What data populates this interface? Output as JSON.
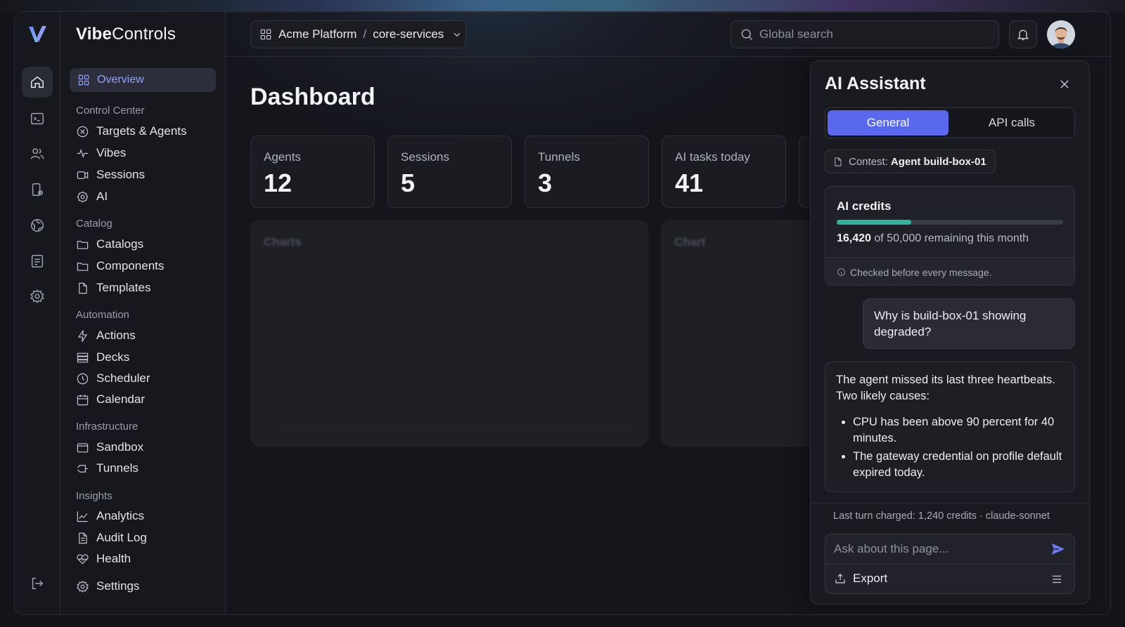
{
  "brand": {
    "bold": "Vibe",
    "rest": "Controls"
  },
  "rail": {
    "icons": [
      "home-icon",
      "terminal-icon",
      "users-icon",
      "device-icon",
      "globe-icon",
      "list-icon",
      "gear-icon"
    ],
    "logout": "logout-icon"
  },
  "sidebar": {
    "overview": "Overview",
    "sections": [
      {
        "title": "Control Center",
        "items": [
          "Targets & Agents",
          "Vibes",
          "Sessions",
          "AI"
        ]
      },
      {
        "title": "Catalog",
        "items": [
          "Catalogs",
          "Components",
          "Templates"
        ]
      },
      {
        "title": "Automation",
        "items": [
          "Actions",
          "Decks",
          "Scheduler",
          "Calendar"
        ]
      },
      {
        "title": "Infrastructure",
        "items": [
          "Sandbox",
          "Tunnels"
        ]
      },
      {
        "title": "Insights",
        "items": [
          "Analytics",
          "Audit Log",
          "Health"
        ]
      }
    ],
    "settings": "Settings"
  },
  "topbar": {
    "workspace": "Acme Platform",
    "separator": "/",
    "project": "core-services",
    "search_placeholder": "Global search"
  },
  "main": {
    "title": "Dashboard",
    "stats": [
      {
        "label": "Agents",
        "value": "12"
      },
      {
        "label": "Sessions",
        "value": "5"
      },
      {
        "label": "Tunnels",
        "value": "3"
      },
      {
        "label": "AI tasks today",
        "value": "41"
      }
    ],
    "chart_titles": [
      "Charts",
      "Chart"
    ]
  },
  "assistant": {
    "title": "AI Assistant",
    "tabs": [
      "General",
      "API calls"
    ],
    "active_tab": "General",
    "context_label": "Contest:",
    "context_value": "Agent build-box-01",
    "credits": {
      "title": "AI credits",
      "remaining": "16,420",
      "total_text": "of 50,000 remaining this month",
      "fraction": 0.328,
      "note": "Checked before every message."
    },
    "user_message": "Why is build-box-01 showing degraded?",
    "ai_message": {
      "intro": "The agent missed its last three heartbeats. Two likely causes:",
      "bullets": [
        "CPU has been above 90 percent for 40 minutes.",
        "The gateway credential on profile default expired today."
      ]
    },
    "charge_line": "Last turn charged: 1,240 credits · claude-sonnet",
    "input_placeholder": "Ask about this page...",
    "export_label": "Export"
  },
  "colors": {
    "accent": "#5a68ee",
    "progress": "#2fb3a0",
    "nav_active": "#8ea2ff"
  }
}
